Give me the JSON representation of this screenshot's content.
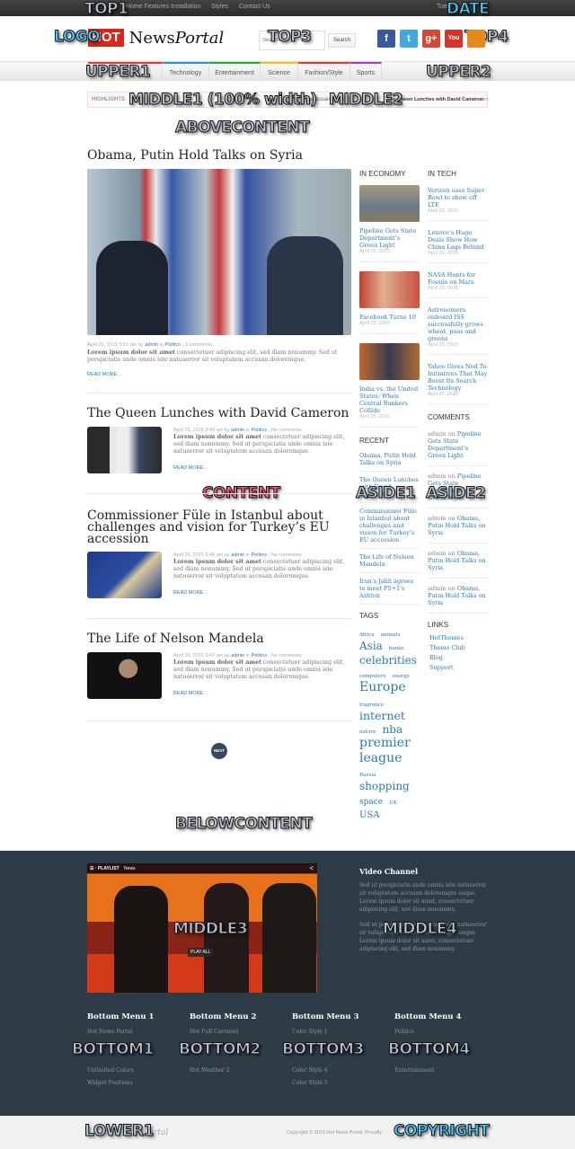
{
  "top_menu": [
    "Home Features",
    "Installation",
    "Styles",
    "Contact Us"
  ],
  "date_partial": "Tue",
  "logo": {
    "hot": "HOT",
    "news": "News",
    "portal": "Portal"
  },
  "search": {
    "placeholder": "Search...",
    "button": "Search"
  },
  "social": [
    {
      "name": "facebook",
      "glyph": "f",
      "color": "#3b5998"
    },
    {
      "name": "twitter",
      "glyph": "t",
      "color": "#3fa9e0"
    },
    {
      "name": "google-plus",
      "glyph": "g+",
      "color": "#d34836"
    },
    {
      "name": "youtube",
      "glyph": "You",
      "color": "#d6332b"
    },
    {
      "name": "rss",
      "glyph": "",
      "color": "#e48a1a"
    }
  ],
  "nav": [
    {
      "label": "Economy",
      "color": "#e33"
    },
    {
      "label": "Technology",
      "color": "#2a8ee0"
    },
    {
      "label": "Entertainment",
      "color": "#2aaa2a"
    },
    {
      "label": "Science",
      "color": "#f2c21a"
    },
    {
      "label": "Fashion/Style",
      "color": "#e33"
    },
    {
      "label": "Sports",
      "color": "#a03cd0"
    }
  ],
  "highlights": {
    "label": "HIGHLIGHTS",
    "text_mid": "accusan",
    "text_right": "The Queen Lunches with David Cameron",
    "text_end": "Lorem"
  },
  "articles": [
    {
      "title": "Obama, Putin Hold Talks on Syria",
      "date": "April 25, 2015 9:51 am",
      "by": "by",
      "author": "admin",
      "in": "in",
      "category": "Politics",
      "comments": "3 comments"
    },
    {
      "title": "The Queen Lunches with David Cameron",
      "date": "April 25, 2015 9:49 am",
      "by": "by",
      "author": "admin",
      "in": "in",
      "category": "Politics",
      "comments": "No comments"
    },
    {
      "title": "Commissioner Füle in Istanbul about challenges and vision for Turkey’s EU accession",
      "date": "April 25, 2015 9:48 am",
      "by": "by",
      "author": "admin",
      "in": "in",
      "category": "Politics",
      "comments": "No comments"
    },
    {
      "title": "The Life of Nelson Mandela",
      "date": "April 25, 2015 9:47 am",
      "by": "by",
      "author": "admin",
      "in": "in",
      "category": "Politics",
      "comments": "No comments"
    }
  ],
  "excerpt": {
    "bold": "Lorem ipsum dolor sit amet",
    "rest": " consectetuer adipiscing elit, sed diam nonummy. Sed ut perspiciatis unde omnis iste natuserror sit voluptatem accusan doloremque."
  },
  "read_more": "READ MORE...",
  "next": "NEXT",
  "economy": {
    "title": "IN ECONOMY",
    "items": [
      {
        "t": "Pipeline Gets State Department’s Green Light",
        "d": "April 25, 2015"
      },
      {
        "t": "Facebook Turns 10",
        "d": "April 25, 2015"
      },
      {
        "t": "India vs. the United States: When Central Bankers Collide",
        "d": "April 25, 2015"
      }
    ]
  },
  "tech": {
    "title": "IN TECH",
    "items": [
      {
        "t": "Verizon uses Super Bowl to show off LTE",
        "d": "April 25, 2015"
      },
      {
        "t": "Lenovo’s Huge Deals Show How China Lags Behind",
        "d": "April 25, 2015"
      },
      {
        "t": "NASA Hunts for Fossils on Mars",
        "d": "April 25, 2015"
      },
      {
        "t": "Astronomers onboard ISS successfully grows wheat, peas and greens",
        "d": "April 25, 2015"
      },
      {
        "t": "Yahoo Gives Nod To Initiatives That May Boost Its Search Technology",
        "d": "April 25, 2015"
      }
    ]
  },
  "recent": {
    "title": "RECENT",
    "items": [
      "Obama, Putin Hold Talks on Syria",
      "The Queen Lunches with David Cameron",
      "Commissioner Füle in Istanbul about challenges and vision for Turkey’s EU accession",
      "The Life of Nelson Mandela",
      "Iran’s Jalili agrees to meet P5+1’s Ashton"
    ]
  },
  "comments": {
    "title": "COMMENTS",
    "items": [
      {
        "a": "admin",
        "on": "on",
        "p": "Pipeline Gets State Department’s Green Light"
      },
      {
        "a": "admin",
        "on": "on",
        "p": "Pipeline Gets State Department’s Green Light"
      },
      {
        "a": "admin",
        "on": "on",
        "p": "Obama, Putin Hold Talks on Syria"
      },
      {
        "a": "admin",
        "on": "on",
        "p": "Obama, Putin Hold Talks on Syria"
      },
      {
        "a": "admin",
        "on": "on",
        "p": "Obama, Putin Hold Talks on Syria"
      }
    ]
  },
  "tags": {
    "title": "TAGS",
    "items": [
      {
        "t": "Africa",
        "s": 5.5
      },
      {
        "t": "animals",
        "s": 5.5
      },
      {
        "t": "Asia",
        "s": 12
      },
      {
        "t": "banks",
        "s": 5.5
      },
      {
        "t": "celebrities",
        "s": 12
      },
      {
        "t": "computers",
        "s": 5.5
      },
      {
        "t": "energy",
        "s": 5.5
      },
      {
        "t": "Europe",
        "s": 14
      },
      {
        "t": "fragrance",
        "s": 5.5
      },
      {
        "t": "internet",
        "s": 12.5
      },
      {
        "t": "nature",
        "s": 5.5
      },
      {
        "t": "nba",
        "s": 12
      },
      {
        "t": "premier league",
        "s": 14
      },
      {
        "t": "Russia",
        "s": 5.5
      },
      {
        "t": "shopping",
        "s": 12
      },
      {
        "t": "space",
        "s": 9
      },
      {
        "t": "UK",
        "s": 5.5
      },
      {
        "t": "USA",
        "s": 10
      }
    ]
  },
  "links": {
    "title": "LINKS",
    "items": [
      "HotThemes",
      "Theme Club",
      "Blog",
      "Support"
    ]
  },
  "video": {
    "playlist": "PLAYLIST",
    "channel_name": "News",
    "play_all": "PLAY ALL"
  },
  "video_channel": {
    "title": "Video Channel",
    "p1": "Sed ut perspiciatis unde omnis iste natuserror sit voluptatem accusan doloremque eaque. Lorem ipsum dolor sit amet, consectetuer adipiscing elit, sed diam nonummy.",
    "p2": "Sed ut perspiciatis unde omnis iste natuserror sit voluptatem accusan doloremque eaque. Lorem ipsum dolor sit amet, consectetuer adipiscing elit, sed diam nonummy."
  },
  "bottom_menus": [
    {
      "title": "Bottom Menu 1",
      "items": [
        "Hot News Portal",
        "",
        "",
        "Unlimited Colors",
        "Widget Positions"
      ]
    },
    {
      "title": "Bottom Menu 2",
      "items": [
        "Hot Full Carousel",
        "",
        "",
        "Hot Weather 2"
      ]
    },
    {
      "title": "Bottom Menu 3",
      "items": [
        "Color Style 1",
        "",
        "",
        "Color Style 4",
        "Color Style 5"
      ]
    },
    {
      "title": "Bottom Menu 4",
      "items": [
        "Politics",
        "",
        "",
        "Entertainment"
      ]
    }
  ],
  "lower_logo_partial": "Portal",
  "copyright": "Copyright © 2015 Hot News Portal. Proudly",
  "overlay_labels": {
    "top1": "TOP1",
    "date": "DATE",
    "logo": "LOGO",
    "top3": "TOP3",
    "top4": "TOP4",
    "upper1": "UPPER1",
    "upper2": "UPPER2",
    "middle1": "MIDDLE1 (100% width)",
    "middle2": "MIDDLE2",
    "abovecontent": "ABOVECONTENT",
    "content": "CONTENT",
    "aside1": "ASIDE1",
    "aside2": "ASIDE2",
    "belowcontent": "BELOWCONTENT",
    "middle3": "MIDDLE3",
    "middle4": "MIDDLE4",
    "bottom1": "BOTTOM1",
    "bottom2": "BOTTOM2",
    "bottom3": "BOTTOM3",
    "bottom4": "BOTTOM4",
    "lower1": "LOWER1",
    "copyright": "COPYRIGHT"
  }
}
